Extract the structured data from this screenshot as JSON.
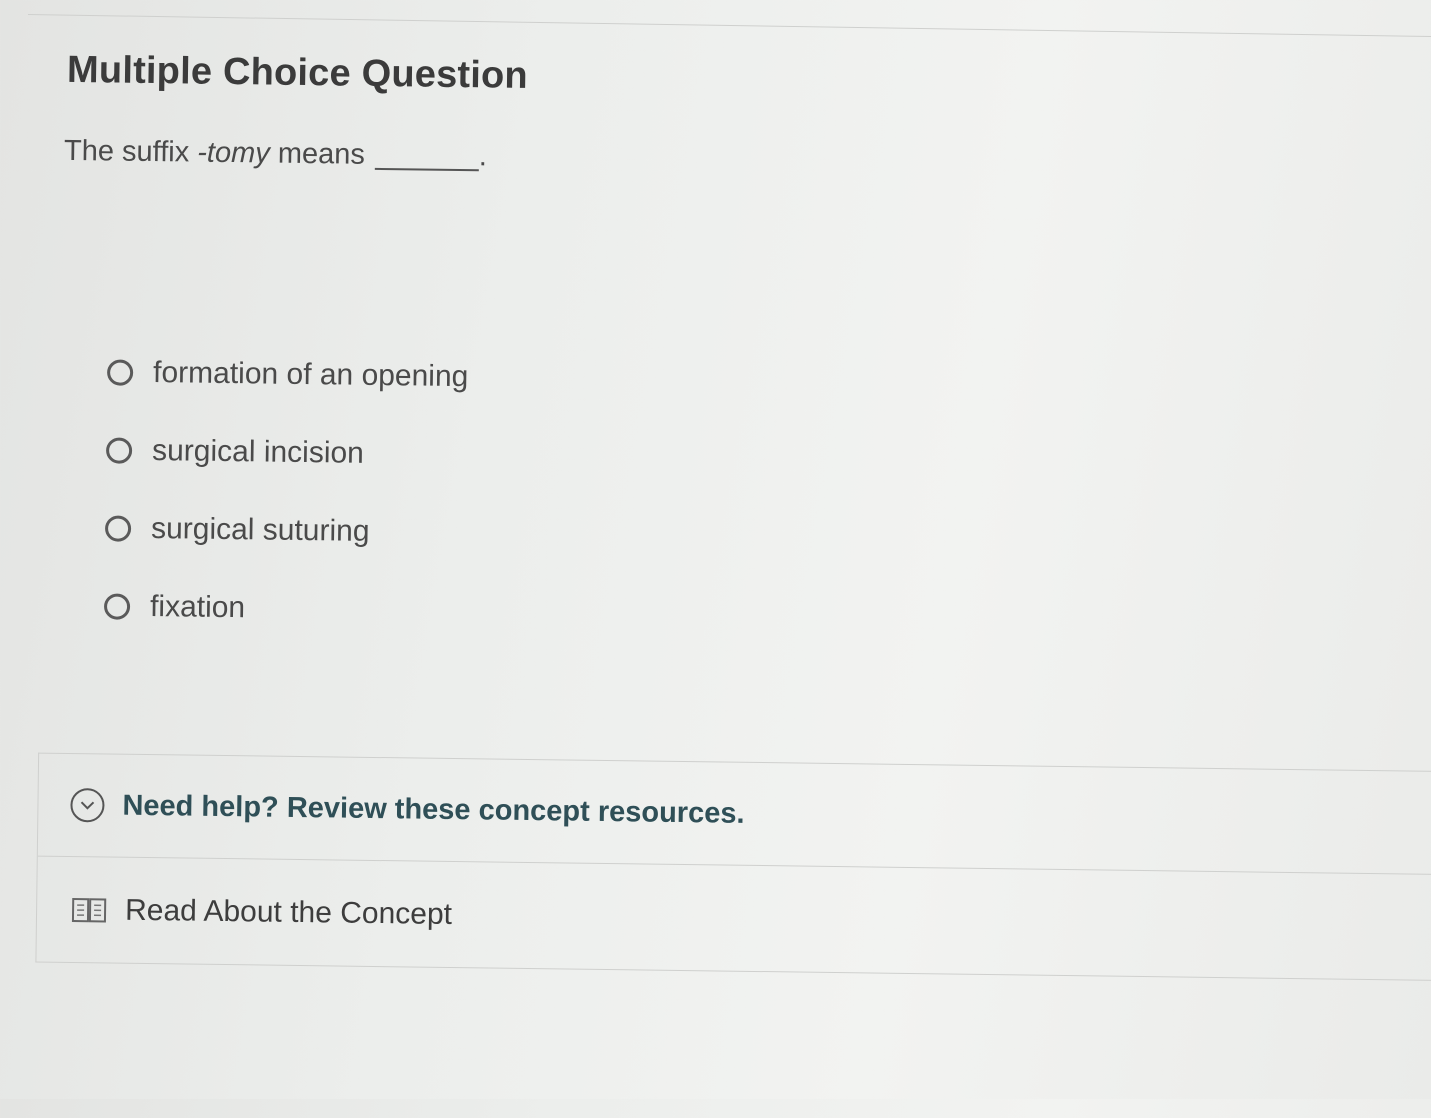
{
  "question": {
    "heading": "Multiple Choice Question",
    "prompt_before": "The suffix ",
    "prompt_italic": "-tomy",
    "prompt_after": " means",
    "prompt_end": "."
  },
  "options": [
    {
      "label": "formation of an opening",
      "selected": false
    },
    {
      "label": "surgical incision",
      "selected": false
    },
    {
      "label": "surgical suturing",
      "selected": false
    },
    {
      "label": "fixation",
      "selected": false
    }
  ],
  "help": {
    "toggle_text": "Need help? Review these concept resources.",
    "toggle_icon": "chevron-down-circle-icon",
    "resources": [
      {
        "label": "Read About the Concept",
        "icon": "book-icon"
      }
    ]
  },
  "colors": {
    "help_text": "#2f4f57",
    "body_text": "#4a4a4a"
  }
}
